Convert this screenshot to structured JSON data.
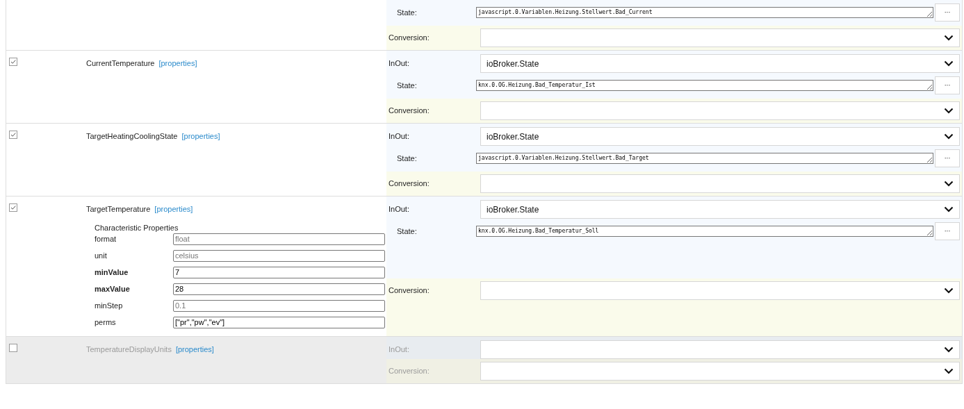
{
  "characteristics": [
    {
      "mapping": [
        {
          "kind": "state",
          "label": "State:",
          "value": "javascript.0.Variablen.Heizung.Stellwert.Bad_Current",
          "button": "···"
        },
        {
          "kind": "select",
          "label": "Conversion:"
        }
      ]
    },
    {
      "enabled": true,
      "name": "CurrentTemperature",
      "link": "[properties]",
      "mapping": [
        {
          "kind": "select",
          "label": "InOut:",
          "value": "ioBroker.State"
        },
        {
          "kind": "state",
          "label": "State:",
          "value": "knx.0.OG.Heizung.Bad_Temperatur_Ist",
          "button": "···"
        },
        {
          "kind": "select",
          "label": "Conversion:"
        }
      ]
    },
    {
      "enabled": true,
      "name": "TargetHeatingCoolingState",
      "link": "[properties]",
      "mapping": [
        {
          "kind": "select",
          "label": "InOut:",
          "value": "ioBroker.State"
        },
        {
          "kind": "state",
          "label": "State:",
          "value": "javascript.0.Variablen.Heizung.Stellwert.Bad_Target",
          "button": "···"
        },
        {
          "kind": "select",
          "label": "Conversion:"
        }
      ]
    },
    {
      "enabled": true,
      "name": "TargetTemperature",
      "link": "[properties]",
      "properties_title": "Characteristic Properties",
      "properties": [
        {
          "label": "format",
          "bold": false,
          "placeholder": "float"
        },
        {
          "label": "unit",
          "bold": false,
          "placeholder": "celsius"
        },
        {
          "label": "minValue",
          "bold": true,
          "value": "7"
        },
        {
          "label": "maxValue",
          "bold": true,
          "value": "28"
        },
        {
          "label": "minStep",
          "bold": false,
          "placeholder": "0.1"
        },
        {
          "label": "perms",
          "bold": false,
          "value": "[\"pr\",\"pw\",\"ev\"]"
        }
      ],
      "mapping": [
        {
          "kind": "select",
          "label": "InOut:",
          "value": "ioBroker.State"
        },
        {
          "kind": "state",
          "label": "State:",
          "value": "knx.0.OG.Heizung.Bad_Temperatur_Soll",
          "button": "···"
        },
        {
          "kind": "select",
          "label": "Conversion:"
        }
      ]
    },
    {
      "enabled": false,
      "name": "TemperatureDisplayUnits",
      "link": "[properties]",
      "mapping": [
        {
          "kind": "select",
          "label": "InOut:"
        },
        {
          "kind": "select",
          "label": "Conversion:"
        }
      ]
    }
  ]
}
